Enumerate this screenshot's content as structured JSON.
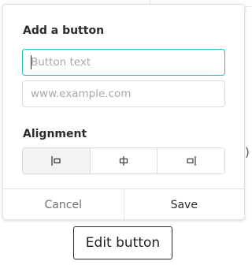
{
  "dialog": {
    "title": "Add a button",
    "button_text": {
      "value": "",
      "placeholder": "Button text"
    },
    "url": {
      "value": "",
      "placeholder": "www.example.com"
    },
    "alignment": {
      "label": "Alignment",
      "options": [
        {
          "name": "left",
          "icon": "align-left-icon",
          "selected": true
        },
        {
          "name": "center",
          "icon": "align-center-icon",
          "selected": false
        },
        {
          "name": "right",
          "icon": "align-right-icon",
          "selected": false
        }
      ]
    },
    "cancel_label": "Cancel",
    "save_label": "Save"
  },
  "edit_button_label": "Edit button",
  "colors": {
    "focus_border": "#27b8c8",
    "text": "#2c2c2c",
    "muted": "#a8a8a8",
    "border": "#dcdcdc",
    "selected_bg": "#f3f3f3"
  }
}
